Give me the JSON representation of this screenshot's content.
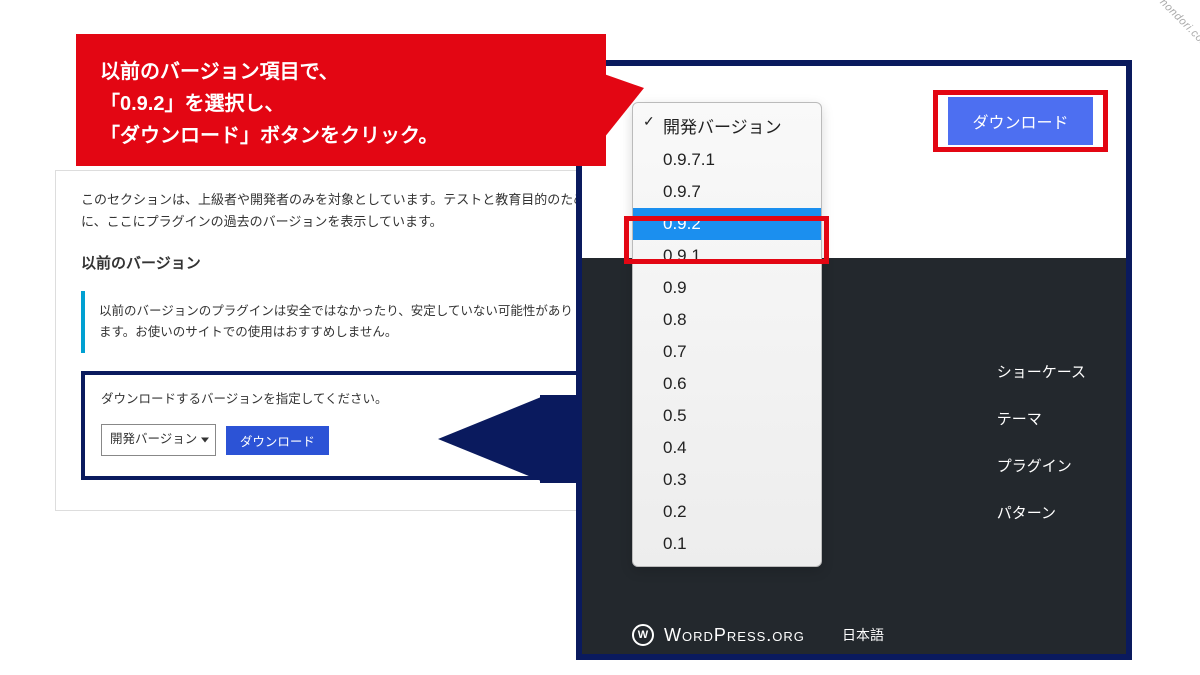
{
  "watermark": "nondori.com",
  "callout": {
    "line1": "以前のバージョン項目で、",
    "line2": "「0.9.2」を選択し、",
    "line3": "「ダウンロード」ボタンをクリック。"
  },
  "left_panel": {
    "desc": "このセクションは、上級者や開発者のみを対象としています。テストと教育目的のために、ここにプラグインの過去のバージョンを表示しています。",
    "heading": "以前のバージョン",
    "notice": "以前のバージョンのプラグインは安全ではなかったり、安定していない可能性があります。お使いのサイトでの使用はおすすめしません。",
    "prompt": "ダウンロードするバージョンを指定してください。",
    "select_value": "開発バージョン",
    "dl_label": "ダウンロード"
  },
  "zoom": {
    "dl_label": "ダウンロード",
    "dropdown": {
      "options": [
        {
          "label": "開発バージョン",
          "checked": true,
          "selected": false
        },
        {
          "label": "0.9.7.1",
          "checked": false,
          "selected": false
        },
        {
          "label": "0.9.7",
          "checked": false,
          "selected": false
        },
        {
          "label": "0.9.2",
          "checked": false,
          "selected": true
        },
        {
          "label": "0.9.1",
          "checked": false,
          "selected": false
        },
        {
          "label": "0.9",
          "checked": false,
          "selected": false
        },
        {
          "label": "0.8",
          "checked": false,
          "selected": false
        },
        {
          "label": "0.7",
          "checked": false,
          "selected": false
        },
        {
          "label": "0.6",
          "checked": false,
          "selected": false
        },
        {
          "label": "0.5",
          "checked": false,
          "selected": false
        },
        {
          "label": "0.4",
          "checked": false,
          "selected": false
        },
        {
          "label": "0.3",
          "checked": false,
          "selected": false
        },
        {
          "label": "0.2",
          "checked": false,
          "selected": false
        },
        {
          "label": "0.1",
          "checked": false,
          "selected": false
        }
      ]
    },
    "footer_links": [
      "ショーケース",
      "テーマ",
      "プラグイン",
      "パターン"
    ],
    "brand_logo": "W",
    "brand_name": "WordPress.org",
    "lang": "日本語"
  }
}
